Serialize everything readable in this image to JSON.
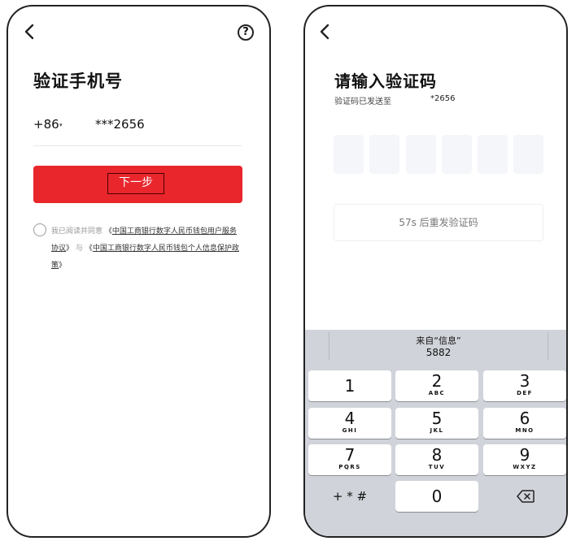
{
  "verify_phone_screen": {
    "title": "验证手机号",
    "country_code": "+86",
    "country_code_caret": "▾",
    "masked_phone": "***2656",
    "next_button_label": "下一步",
    "agreement": {
      "prefix": "我已阅读并同意",
      "open_bracket_1": "《",
      "link_1": "中国工商银行数字人民币钱包用户服务协议",
      "close_bracket_1": "》",
      "conjunction": "与",
      "open_bracket_2": "《",
      "link_2": "中国工商银行数字人民币钱包个人信息保护政策",
      "close_bracket_2": "》"
    },
    "icons": {
      "back": "chevron-left-icon",
      "help": "help-icon"
    },
    "help_glyph": "?"
  },
  "enter_code_screen": {
    "title": "请输入验证码",
    "sent_to_label": "验证码已发送至",
    "sent_to_number": "*2656",
    "code_boxes": [
      "",
      "",
      "",
      "",
      "",
      ""
    ],
    "resend_label": "57s 后重发验证码",
    "icons": {
      "back": "chevron-left-icon"
    }
  },
  "keyboard": {
    "suggestion_line1": "来自“信息”",
    "suggestion_line2": "5882",
    "keys": [
      {
        "num": "1",
        "letters": ""
      },
      {
        "num": "2",
        "letters": "ABC"
      },
      {
        "num": "3",
        "letters": "DEF"
      },
      {
        "num": "4",
        "letters": "GHI"
      },
      {
        "num": "5",
        "letters": "JKL"
      },
      {
        "num": "6",
        "letters": "MNO"
      },
      {
        "num": "7",
        "letters": "PQRS"
      },
      {
        "num": "8",
        "letters": "TUV"
      },
      {
        "num": "9",
        "letters": "WXYZ"
      }
    ],
    "symbols_key": "+ * #",
    "zero_key": "0",
    "backspace_icon": "backspace-icon"
  },
  "colors": {
    "primary_red": "#e8262c",
    "code_box_bg": "#f4f6fa",
    "keyboard_bg": "#d0d3d9"
  }
}
